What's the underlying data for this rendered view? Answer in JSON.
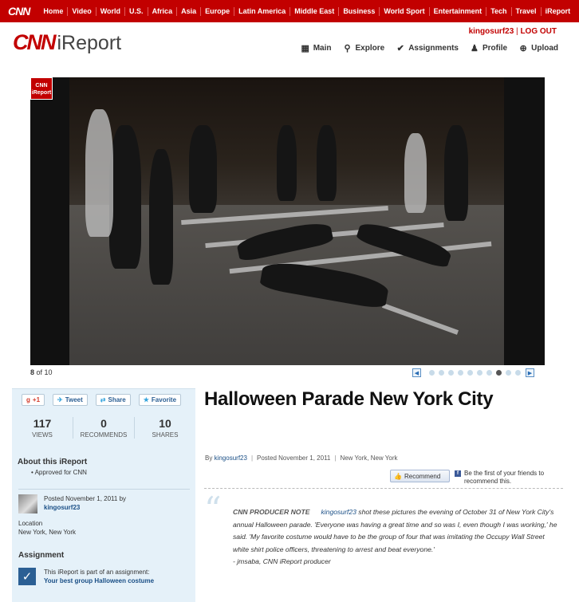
{
  "topnav": {
    "logo": "CNN",
    "links": [
      "Home",
      "Video",
      "World",
      "U.S.",
      "Africa",
      "Asia",
      "Europe",
      "Latin America",
      "Middle East",
      "Business",
      "World Sport",
      "Entertainment",
      "Tech",
      "Travel",
      "iReport"
    ]
  },
  "header": {
    "logo_cnn": "CNN",
    "logo_ireport": "iReport",
    "username": "kingosurf23",
    "separator": " | ",
    "logout": "LOG OUT",
    "nav": [
      {
        "label": "Main",
        "icon": "main-icon"
      },
      {
        "label": "Explore",
        "icon": "search-icon"
      },
      {
        "label": "Assignments",
        "icon": "check-icon"
      },
      {
        "label": "Profile",
        "icon": "person-icon"
      },
      {
        "label": "Upload",
        "icon": "upload-icon"
      }
    ]
  },
  "gallery": {
    "badge_top": "CNN",
    "badge_bottom": "iReport",
    "current": "8",
    "of_label": " of ",
    "total": "10",
    "dot_count": 10,
    "active_dot": 8
  },
  "sidebar": {
    "social": {
      "gplus": "+1",
      "tweet": "Tweet",
      "share": "Share",
      "favorite": "Favorite"
    },
    "stats": [
      {
        "value": "117",
        "label": "VIEWS"
      },
      {
        "value": "0",
        "label": "RECOMMENDS"
      },
      {
        "value": "10",
        "label": "SHARES"
      }
    ],
    "about_title": "About this iReport",
    "approved": "Approved for CNN",
    "posted_label": "Posted November 1, 2011 by",
    "posted_user": "kingosurf23",
    "location_label": "Location",
    "location_value": "New York, New York",
    "assignment_title": "Assignment",
    "assignment_text": "This iReport is part of an assignment:",
    "assignment_link": "Your best group Halloween costume"
  },
  "article": {
    "title": "Halloween Parade New York City",
    "by_label": "By",
    "author": "kingosurf23",
    "posted": "Posted November 1, 2011",
    "location": "New York, New York",
    "recommend_label": "Recommend",
    "fb_note": "Be the first of your friends to recommend this.",
    "note_heading": "CNN PRODUCER NOTE",
    "note_user": "kingosurf23",
    "note_body": " shot these pictures the evening of October 31 of New York City's annual Halloween parade. 'Everyone was having a great time and so was I, even though I was working,' he said. 'My favorite costume would have to be the group of four that was imitating the Occupy Wall Street white shirt police officers, threatening to arrest and beat everyone.'",
    "note_sign": "- jmsaba, CNN iReport producer"
  },
  "colors": {
    "brand_red": "#c20000",
    "link_blue": "#1a4f86",
    "sidebar_bg": "#e5f1f9"
  }
}
